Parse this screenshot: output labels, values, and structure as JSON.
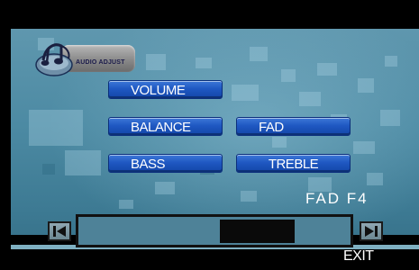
{
  "logo": {
    "text": "AUDIO ADJUST"
  },
  "menu": {
    "volume_label": "VOLUME",
    "balance_label": "BALANCE",
    "fad_label": "FAD",
    "bass_label": "BASS",
    "treble_label": "TREBLE"
  },
  "status": {
    "text": "FAD  F4"
  },
  "slider": {
    "setting": "FAD",
    "value_text": "F4",
    "level_start": 0.52,
    "level_end": 0.8
  },
  "nav": {
    "prev_icon": "skip-back-icon",
    "next_icon": "skip-forward-icon"
  },
  "footer": {
    "exit_label": "EXIT"
  },
  "colors": {
    "background": "#4c8aa3",
    "button": "#1f58c2",
    "text": "#ffffff"
  }
}
